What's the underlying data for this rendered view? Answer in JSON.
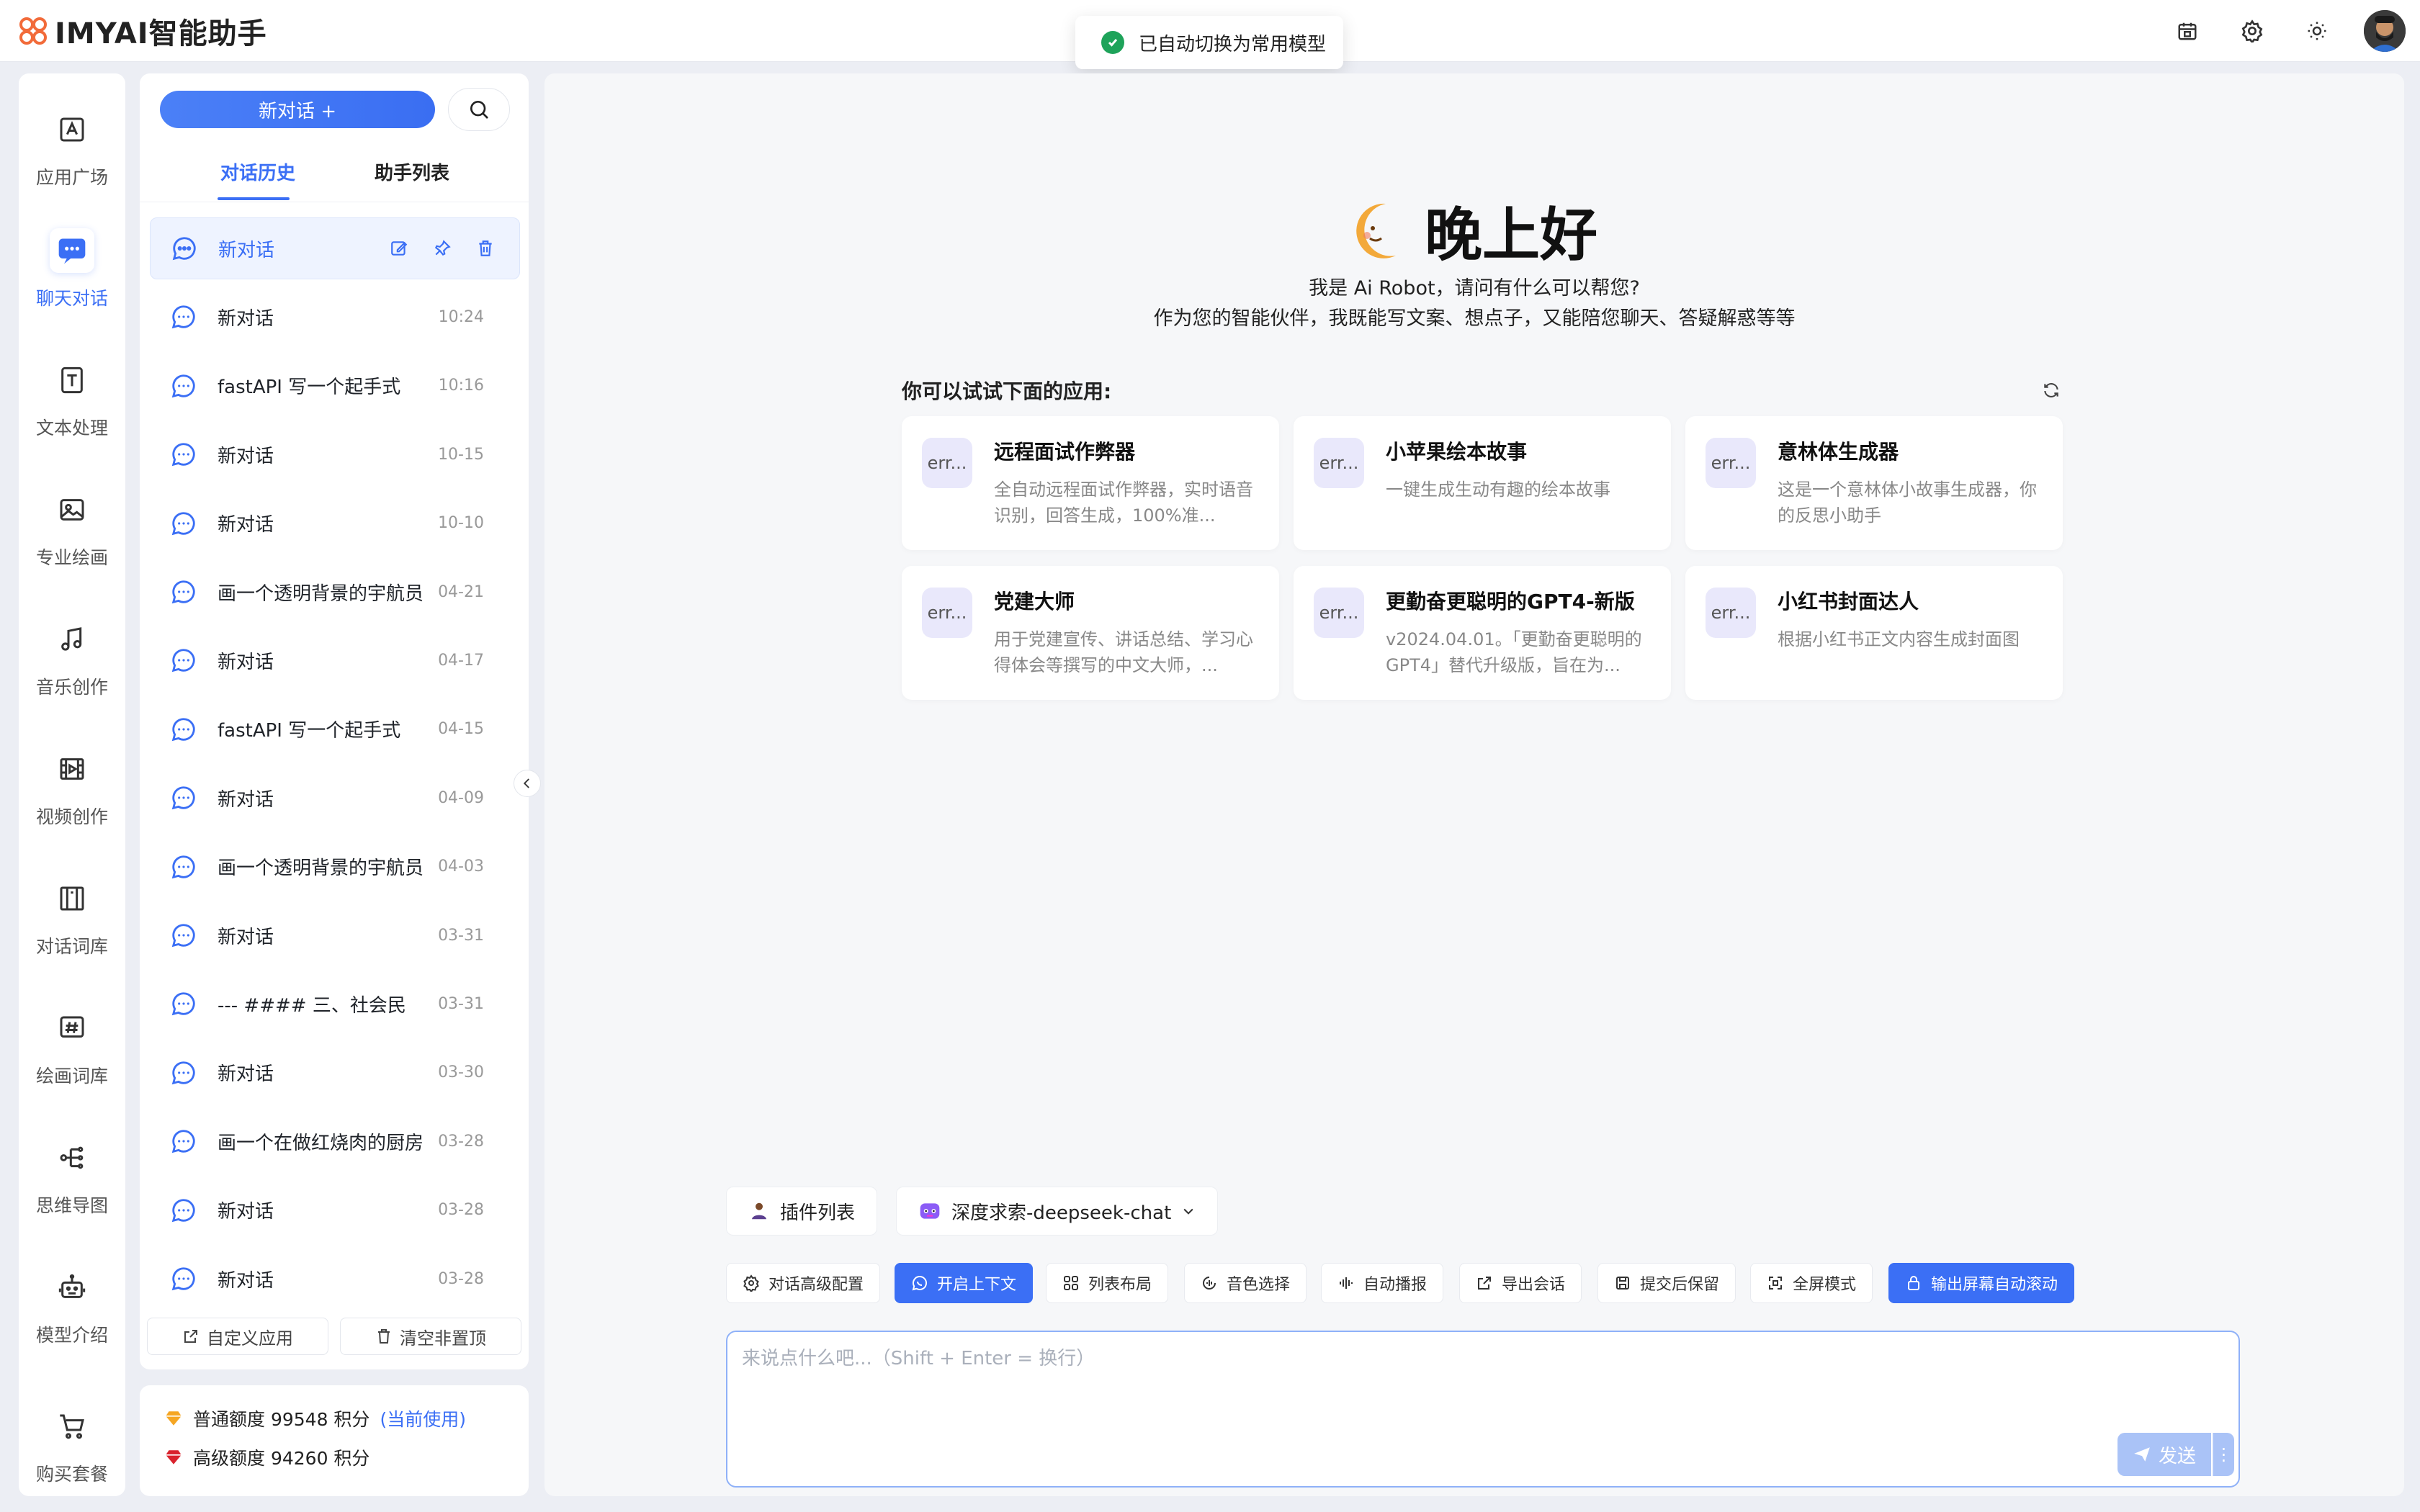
{
  "app": {
    "logo_text": "IMYAI智能助手"
  },
  "toast": {
    "text": "已自动切换为常用模型"
  },
  "topbar": {
    "icons": [
      "calendar-icon",
      "gear-icon",
      "sun-icon",
      "user-avatar"
    ]
  },
  "nav": {
    "items": [
      {
        "label": "应用广场",
        "icon": "app-square-icon"
      },
      {
        "label": "聊天对话",
        "icon": "chat-icon",
        "active": true
      },
      {
        "label": "文本处理",
        "icon": "text-icon"
      },
      {
        "label": "专业绘画",
        "icon": "image-icon"
      },
      {
        "label": "音乐创作",
        "icon": "music-icon"
      },
      {
        "label": "视频创作",
        "icon": "video-icon"
      },
      {
        "label": "对话词库",
        "icon": "book-icon"
      },
      {
        "label": "绘画词库",
        "icon": "hash-icon"
      },
      {
        "label": "思维导图",
        "icon": "mindmap-icon"
      },
      {
        "label": "模型介绍",
        "icon": "robot-icon"
      },
      {
        "label": "购买套餐",
        "icon": "cart-icon"
      }
    ]
  },
  "sidepanel": {
    "new_chat_label": "新对话 +",
    "tabs": [
      {
        "label": "对话历史",
        "active": true
      },
      {
        "label": "助手列表"
      }
    ],
    "conversations": [
      {
        "title": "新对话",
        "time": "",
        "active": true
      },
      {
        "title": "新对话",
        "time": "10:24"
      },
      {
        "title": "fastAPI 写一个起手式",
        "time": "10:16"
      },
      {
        "title": "新对话",
        "time": "10-15"
      },
      {
        "title": "新对话",
        "time": "10-10"
      },
      {
        "title": "画一个透明背景的宇航员",
        "time": "04-21"
      },
      {
        "title": "新对话",
        "time": "04-17"
      },
      {
        "title": "fastAPI 写一个起手式",
        "time": "04-15"
      },
      {
        "title": "新对话",
        "time": "04-09"
      },
      {
        "title": "画一个透明背景的宇航员",
        "time": "04-03"
      },
      {
        "title": "新对话",
        "time": "03-31"
      },
      {
        "title": "--- #### 三、社会民",
        "time": "03-31"
      },
      {
        "title": "新对话",
        "time": "03-30"
      },
      {
        "title": "画一个在做红烧肉的厨房",
        "time": "03-28"
      },
      {
        "title": "新对话",
        "time": "03-28"
      },
      {
        "title": "新对话",
        "time": "03-28"
      }
    ],
    "footer": {
      "custom_app": "自定义应用",
      "clear_unpinned": "清空非置顶"
    }
  },
  "quota": {
    "normal": "普通额度 99548 积分",
    "normal_note": "(当前使用)",
    "advanced": "高级额度 94260 积分"
  },
  "main": {
    "greeting": "晚上好",
    "intro_line1": "我是 Ai Robot，请问有什么可以帮您?",
    "intro_line2": "作为您的智能伙伴，我既能写文案、想点子，又能陪您聊天、答疑解惑等等",
    "apps_title": "你可以试试下面的应用:",
    "apps": [
      {
        "avatar": "err...",
        "name": "远程面试作弊器",
        "desc": "全自动远程面试作弊器，实时语音识别，回答生成，100%准..."
      },
      {
        "avatar": "err...",
        "name": "小苹果绘本故事",
        "desc": "一键生成生动有趣的绘本故事"
      },
      {
        "avatar": "err...",
        "name": "意林体生成器",
        "desc": "这是一个意林体小故事生成器，你的反思小助手"
      },
      {
        "avatar": "err...",
        "name": "党建大师",
        "desc": "用于党建宣传、讲话总结、学习心得体会等撰写的中文大师，..."
      },
      {
        "avatar": "err...",
        "name": "更勤奋更聪明的GPT4-新版",
        "desc": "v2024.04.01。「更勤奋更聪明的GPT4」替代升级版，旨在为..."
      },
      {
        "avatar": "err...",
        "name": "小红书封面达人",
        "desc": "根据小红书正文内容生成封面图"
      }
    ],
    "plugin_label": "插件列表",
    "model_label": "深度求索-deepseek-chat",
    "tools": [
      {
        "label": "对话高级配置",
        "icon": "gear-icon"
      },
      {
        "label": "开启上下文",
        "icon": "context-icon",
        "on": true
      },
      {
        "label": "列表布局",
        "icon": "grid-icon"
      },
      {
        "label": "音色选择",
        "icon": "voice-icon"
      },
      {
        "label": "自动播报",
        "icon": "wave-icon"
      },
      {
        "label": "导出会话",
        "icon": "export-icon"
      },
      {
        "label": "提交后保留",
        "icon": "save-icon"
      },
      {
        "label": "全屏模式",
        "icon": "fullscreen-icon"
      },
      {
        "label": "输出屏幕自动滚动",
        "icon": "lock-icon",
        "on": true
      }
    ],
    "input_placeholder": "来说点什么吧...（Shift + Enter = 换行）",
    "send_label": "发送"
  },
  "colors": {
    "accent": "#3b6ff5",
    "success": "#1ea35a"
  }
}
